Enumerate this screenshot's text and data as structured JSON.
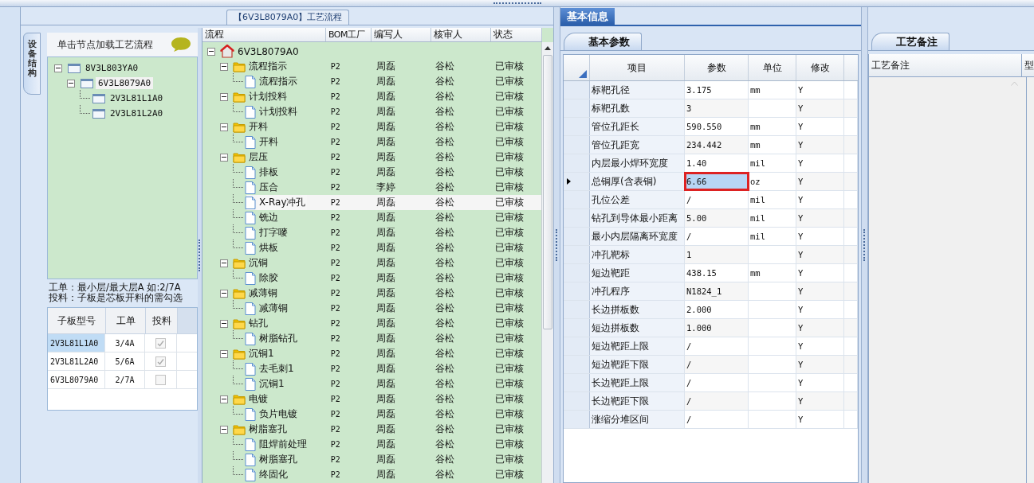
{
  "flow_panel": {
    "title": "【6V3L8079A0】工艺流程",
    "side_tab": {
      "label": "设备结构",
      "selected": true
    },
    "structure": {
      "hint": "单击节点加载工艺流程",
      "tree": [
        {
          "label": "8V3L803YA0",
          "expanded": true,
          "selected": false,
          "children": [
            {
              "label": "6V3L8079A0",
              "expanded": true,
              "selected": true,
              "children": [
                {
                  "label": "2V3L81L1A0",
                  "selected": false
                },
                {
                  "label": "2V3L81L2A0",
                  "selected": false
                }
              ]
            }
          ]
        }
      ],
      "notes": [
        "工单：最小层/最大层A 如:2/7A",
        "投料：子板是芯板开料的需勾选"
      ],
      "columns": [
        "子板型号",
        "工单",
        "投料"
      ],
      "rows": [
        {
          "board": "2V3L81L1A0",
          "order": "3/4A",
          "checked": true,
          "selected": true
        },
        {
          "board": "2V3L81L2A0",
          "order": "5/6A",
          "checked": true,
          "selected": false
        },
        {
          "board": "6V3L8079A0",
          "order": "2/7A",
          "checked": false,
          "selected": false
        }
      ]
    },
    "columns": [
      "流程",
      "BOM工厂",
      "编写人",
      "核审人",
      "状态"
    ],
    "tree": [
      {
        "label": "6V3L8079A0",
        "kind": "home",
        "expanded": true,
        "selected": false,
        "children": [
          {
            "label": "流程指示",
            "kind": "folder",
            "bom": "P2",
            "writer": "周磊",
            "reviewer": "谷松",
            "status": "已审核",
            "expanded": true,
            "selected": false,
            "children": [
              {
                "label": "流程指示",
                "kind": "doc",
                "bom": "P2",
                "writer": "周磊",
                "reviewer": "谷松",
                "status": "已审核",
                "selected": false
              }
            ]
          },
          {
            "label": "计划投料",
            "kind": "folder",
            "bom": "P2",
            "writer": "周磊",
            "reviewer": "谷松",
            "status": "已审核",
            "expanded": true,
            "selected": false,
            "children": [
              {
                "label": "计划投料",
                "kind": "doc",
                "bom": "P2",
                "writer": "周磊",
                "reviewer": "谷松",
                "status": "已审核",
                "selected": false
              }
            ]
          },
          {
            "label": "开料",
            "kind": "folder",
            "bom": "P2",
            "writer": "周磊",
            "reviewer": "谷松",
            "status": "已审核",
            "expanded": true,
            "selected": false,
            "children": [
              {
                "label": "开料",
                "kind": "doc",
                "bom": "P2",
                "writer": "周磊",
                "reviewer": "谷松",
                "status": "已审核",
                "selected": false
              }
            ]
          },
          {
            "label": "层压",
            "kind": "folder",
            "bom": "P2",
            "writer": "周磊",
            "reviewer": "谷松",
            "status": "已审核",
            "expanded": true,
            "selected": false,
            "children": [
              {
                "label": "排板",
                "kind": "doc",
                "bom": "P2",
                "writer": "周磊",
                "reviewer": "谷松",
                "status": "已审核",
                "selected": false
              },
              {
                "label": "压合",
                "kind": "doc",
                "bom": "P2",
                "writer": "李婷",
                "reviewer": "谷松",
                "status": "已审核",
                "selected": false
              },
              {
                "label": "X-Ray冲孔",
                "kind": "doc",
                "bom": "P2",
                "writer": "周磊",
                "reviewer": "谷松",
                "status": "已审核",
                "selected": true
              },
              {
                "label": "铣边",
                "kind": "doc",
                "bom": "P2",
                "writer": "周磊",
                "reviewer": "谷松",
                "status": "已审核",
                "selected": false
              },
              {
                "label": "打字嘜",
                "kind": "doc",
                "bom": "P2",
                "writer": "周磊",
                "reviewer": "谷松",
                "status": "已审核",
                "selected": false
              },
              {
                "label": "烘板",
                "kind": "doc",
                "bom": "P2",
                "writer": "周磊",
                "reviewer": "谷松",
                "status": "已审核",
                "selected": false
              }
            ]
          },
          {
            "label": "沉铜",
            "kind": "folder",
            "bom": "P2",
            "writer": "周磊",
            "reviewer": "谷松",
            "status": "已审核",
            "expanded": true,
            "selected": false,
            "children": [
              {
                "label": "除胶",
                "kind": "doc",
                "bom": "P2",
                "writer": "周磊",
                "reviewer": "谷松",
                "status": "已审核",
                "selected": false
              }
            ]
          },
          {
            "label": "减薄铜",
            "kind": "folder",
            "bom": "P2",
            "writer": "周磊",
            "reviewer": "谷松",
            "status": "已审核",
            "expanded": true,
            "selected": false,
            "children": [
              {
                "label": "减薄铜",
                "kind": "doc",
                "bom": "P2",
                "writer": "周磊",
                "reviewer": "谷松",
                "status": "已审核",
                "selected": false
              }
            ]
          },
          {
            "label": "钻孔",
            "kind": "folder",
            "bom": "P2",
            "writer": "周磊",
            "reviewer": "谷松",
            "status": "已审核",
            "expanded": true,
            "selected": false,
            "children": [
              {
                "label": "树脂钻孔",
                "kind": "doc",
                "bom": "P2",
                "writer": "周磊",
                "reviewer": "谷松",
                "status": "已审核",
                "selected": false
              }
            ]
          },
          {
            "label": "沉铜1",
            "kind": "folder",
            "bom": "P2",
            "writer": "周磊",
            "reviewer": "谷松",
            "status": "已审核",
            "expanded": true,
            "selected": false,
            "children": [
              {
                "label": "去毛刺1",
                "kind": "doc",
                "bom": "P2",
                "writer": "周磊",
                "reviewer": "谷松",
                "status": "已审核",
                "selected": false
              },
              {
                "label": "沉铜1",
                "kind": "doc",
                "bom": "P2",
                "writer": "周磊",
                "reviewer": "谷松",
                "status": "已审核",
                "selected": false
              }
            ]
          },
          {
            "label": "电镀",
            "kind": "folder",
            "bom": "P2",
            "writer": "周磊",
            "reviewer": "谷松",
            "status": "已审核",
            "expanded": true,
            "selected": false,
            "children": [
              {
                "label": "负片电镀",
                "kind": "doc",
                "bom": "P2",
                "writer": "周磊",
                "reviewer": "谷松",
                "status": "已审核",
                "selected": false
              }
            ]
          },
          {
            "label": "树脂塞孔",
            "kind": "folder",
            "bom": "P2",
            "writer": "周磊",
            "reviewer": "谷松",
            "status": "已审核",
            "expanded": true,
            "selected": false,
            "children": [
              {
                "label": "阻焊前处理",
                "kind": "doc",
                "bom": "P2",
                "writer": "周磊",
                "reviewer": "谷松",
                "status": "已审核",
                "selected": false
              },
              {
                "label": "树脂塞孔",
                "kind": "doc",
                "bom": "P2",
                "writer": "周磊",
                "reviewer": "谷松",
                "status": "已审核",
                "selected": false
              },
              {
                "label": "终固化",
                "kind": "doc",
                "bom": "P2",
                "writer": "周磊",
                "reviewer": "谷松",
                "status": "已审核",
                "selected": false
              }
            ]
          }
        ]
      }
    ]
  },
  "info_panel": {
    "tab": {
      "label": "基本信息",
      "selected": true
    },
    "sub_tab": {
      "label": "基本参数",
      "selected": true
    },
    "columns": [
      "项目",
      "参数",
      "单位",
      "修改"
    ],
    "rows": [
      {
        "item": "标靶孔径",
        "value": "3.175",
        "unit": "mm",
        "modify": "Y",
        "selected": false,
        "marked": false
      },
      {
        "item": "标靶孔数",
        "value": "3",
        "modify": "Y",
        "selected": false,
        "marked": false
      },
      {
        "item": "管位孔距长",
        "value": "590.550",
        "unit": "mm",
        "modify": "Y",
        "selected": false,
        "marked": false
      },
      {
        "item": "管位孔距宽",
        "value": "234.442",
        "unit": "mm",
        "modify": "Y",
        "selected": false,
        "marked": false
      },
      {
        "item": "内层最小焊环宽度",
        "value": "1.40",
        "unit": "mil",
        "modify": "Y",
        "selected": false,
        "marked": false
      },
      {
        "item": "总铜厚(含表铜)",
        "value": "6.66",
        "unit": "oz",
        "modify": "Y",
        "selected": true,
        "marked": true
      },
      {
        "item": "孔位公差",
        "value": "/",
        "unit": "mil",
        "modify": "Y",
        "selected": false,
        "marked": false
      },
      {
        "item": "钻孔到导体最小距离",
        "value": "5.00",
        "unit": "mil",
        "modify": "Y",
        "selected": false,
        "marked": false
      },
      {
        "item": "最小内层隔离环宽度",
        "value": "/",
        "unit": "mil",
        "modify": "Y",
        "selected": false,
        "marked": false
      },
      {
        "item": "冲孔靶标",
        "value": "1",
        "modify": "Y",
        "selected": false,
        "marked": false
      },
      {
        "item": "短边靶距",
        "value": "438.15",
        "unit": "mm",
        "modify": "Y",
        "selected": false,
        "marked": false
      },
      {
        "item": "冲孔程序",
        "value": "N1824_1",
        "modify": "Y",
        "selected": false,
        "marked": false
      },
      {
        "item": "长边拼板数",
        "value": "2.000",
        "modify": "Y",
        "selected": false,
        "marked": false
      },
      {
        "item": "短边拼板数",
        "value": "1.000",
        "modify": "Y",
        "selected": false,
        "marked": false
      },
      {
        "item": "短边靶距上限",
        "value": "/",
        "modify": "Y",
        "selected": false,
        "marked": false
      },
      {
        "item": "短边靶距下限",
        "value": "/",
        "modify": "Y",
        "selected": false,
        "marked": false
      },
      {
        "item": "长边靶距上限",
        "value": "/",
        "modify": "Y",
        "selected": false,
        "marked": false
      },
      {
        "item": "长边靶距下限",
        "value": "/",
        "modify": "Y",
        "selected": false,
        "marked": false
      },
      {
        "item": "涨缩分堆区间",
        "value": "/",
        "modify": "Y",
        "selected": false,
        "marked": false
      }
    ]
  },
  "notes_panel": {
    "tab": {
      "label": "工艺备注",
      "selected": true
    },
    "columns": [
      "工艺备注",
      "型"
    ]
  }
}
